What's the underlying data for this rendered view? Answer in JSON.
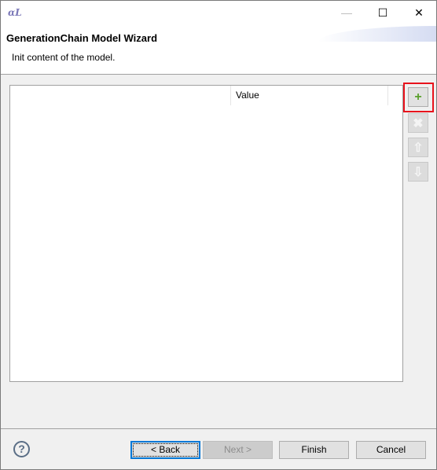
{
  "window": {
    "app_icon": "ocl-icon",
    "minimize": "—",
    "maximize": "☐",
    "close": "✕"
  },
  "header": {
    "title": "GenerationChain Model Wizard",
    "subtitle": "Init content of the model."
  },
  "table": {
    "columns": [
      "",
      "Value"
    ],
    "rows": []
  },
  "side_buttons": {
    "add": "+",
    "remove": "✖",
    "up": "⇧",
    "down": "⇩"
  },
  "footer": {
    "help": "?",
    "back": "< Back",
    "next": "Next >",
    "finish": "Finish",
    "cancel": "Cancel"
  },
  "colors": {
    "highlight": "#e8121c",
    "accent": "#0078d7"
  }
}
